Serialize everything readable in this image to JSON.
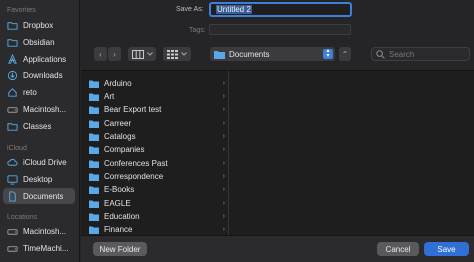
{
  "sidebar": {
    "sections": [
      {
        "heading": "Favorites",
        "items": [
          "Dropbox",
          "Obsidian",
          "Applications",
          "Downloads",
          "reto",
          "Macintosh...",
          "Classes"
        ]
      },
      {
        "heading": "iCloud",
        "items": [
          "iCloud Drive",
          "Desktop",
          "Documents"
        ]
      },
      {
        "heading": "Locations",
        "items": [
          "Macintosh...",
          "TimeMachi..."
        ]
      }
    ],
    "selected": "Documents",
    "icons": {
      "Dropbox": "folder-icon",
      "Obsidian": "folder-icon",
      "Applications": "applications-icon",
      "Downloads": "downloads-icon",
      "reto": "home-icon",
      "Macintosh...": "disk-icon",
      "Classes": "folder-icon",
      "iCloud Drive": "cloud-icon",
      "Desktop": "desktop-icon",
      "Documents": "document-icon",
      "TimeMachi...": "disk-icon"
    }
  },
  "save_as": {
    "label": "Save As:",
    "value": "Untitled 2"
  },
  "tags": {
    "label": "Tags:",
    "value": ""
  },
  "toolbar": {
    "back": "‹",
    "forward": "›",
    "view_icon": "columns-view-icon",
    "group_icon": "grid-group-icon",
    "location": "Documents",
    "expand": "⌃",
    "search_placeholder": "Search"
  },
  "files": [
    "Arduino",
    "Art",
    "Bear Export test",
    "Carreer",
    "Catalogs",
    "Companies",
    "Conferences Past",
    "Correspondence",
    "E-Books",
    "EAGLE",
    "Education",
    "Finance"
  ],
  "buttons": {
    "new_folder": "New Folder",
    "cancel": "Cancel",
    "save": "Save"
  },
  "colors": {
    "accent": "#2f6fd6",
    "folder": "#5aa9e6",
    "background": "#1e1e1f",
    "sidebar": "#2b2b2d"
  }
}
